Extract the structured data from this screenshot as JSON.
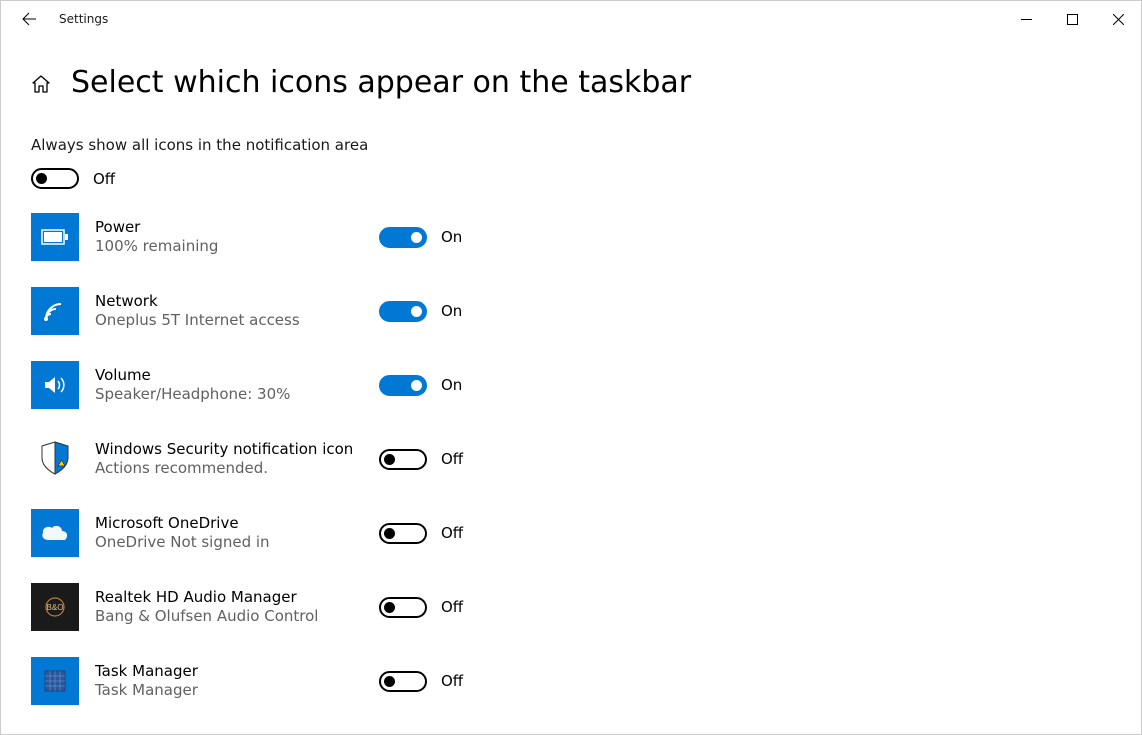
{
  "titlebar": {
    "title": "Settings"
  },
  "page": {
    "title": "Select which icons appear on the taskbar"
  },
  "master": {
    "label": "Always show all icons in the notification area",
    "state": "Off",
    "on": false
  },
  "items": [
    {
      "icon": "battery-icon",
      "title": "Power",
      "sub": "100% remaining",
      "on": true,
      "state": "On"
    },
    {
      "icon": "wifi-icon",
      "title": "Network",
      "sub": "Oneplus 5T Internet access",
      "on": true,
      "state": "On"
    },
    {
      "icon": "volume-icon",
      "title": "Volume",
      "sub": "Speaker/Headphone: 30%",
      "on": true,
      "state": "On"
    },
    {
      "icon": "shield-icon",
      "title": "Windows Security notification icon",
      "sub": "Actions recommended.",
      "on": false,
      "state": "Off"
    },
    {
      "icon": "onedrive-icon",
      "title": "Microsoft OneDrive",
      "sub": "OneDrive Not signed in",
      "on": false,
      "state": "Off"
    },
    {
      "icon": "realtek-icon",
      "title": "Realtek HD Audio Manager",
      "sub": "Bang & Olufsen Audio Control",
      "on": false,
      "state": "Off",
      "dark": true
    },
    {
      "icon": "taskmgr-icon",
      "title": "Task Manager",
      "sub": "Task Manager",
      "on": false,
      "state": "Off"
    }
  ]
}
